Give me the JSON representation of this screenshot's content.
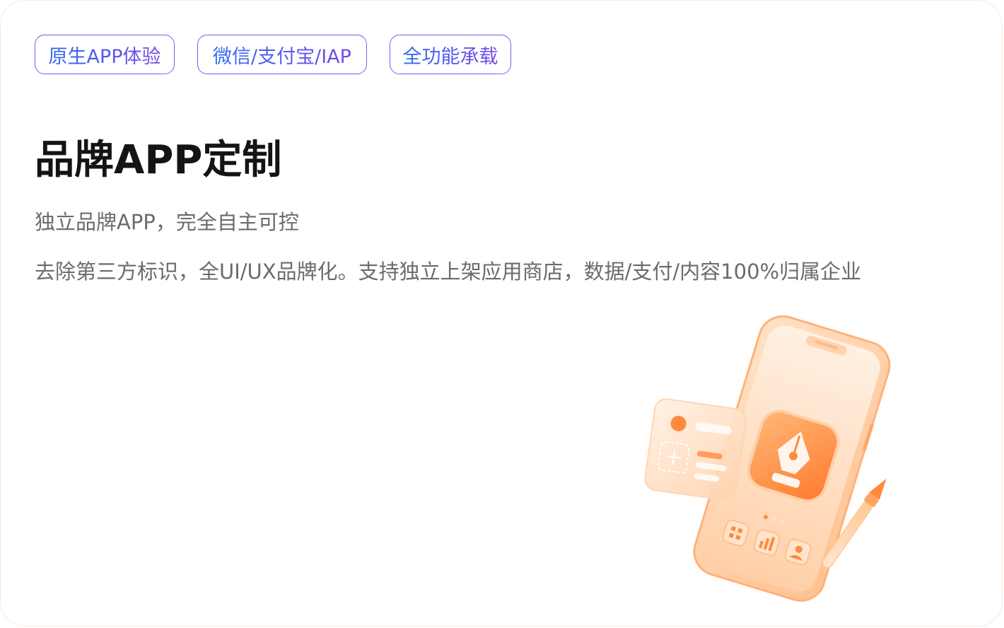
{
  "tags": [
    "原生APP体验",
    "微信/支付宝/IAP",
    "全功能承载"
  ],
  "title": "品牌APP定制",
  "subtitle": "独立品牌APP，完全自主可控",
  "description": "去除第三方标识，全UI/UX品牌化。支持独立上架应用商店，数据/支付/内容100%归属企业",
  "colors": {
    "tag_gradient_start": "#2f6bf2",
    "tag_gradient_end": "#7b48e8",
    "title": "#141414",
    "body_text": "#6b6b6b",
    "illustration_accent": "#ff8a3d"
  },
  "illustration": {
    "icons": [
      "smartphone-icon",
      "pen-nib-icon",
      "paintbrush-icon",
      "grid-icon",
      "bar-chart-icon",
      "user-icon",
      "plus-icon"
    ]
  }
}
